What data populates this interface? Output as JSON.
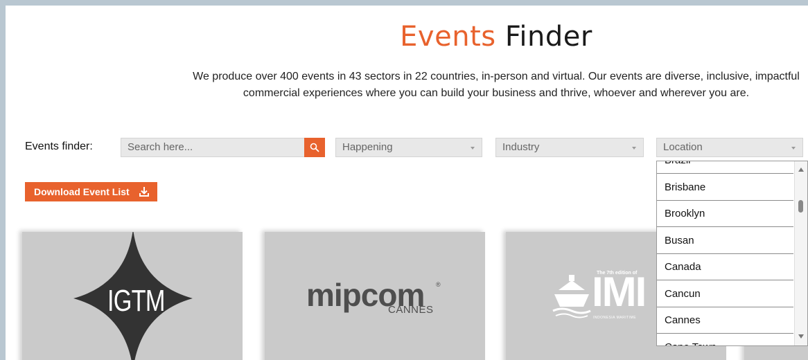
{
  "header": {
    "title_accent": "Events",
    "title_rest": "Finder",
    "intro_line1": "We produce over 400 events in 43 sectors in 22 countries, in-person and virtual. Our events are diverse, inclusive, impactful",
    "intro_line2": "commercial experiences where you can build your business and thrive, whoever and wherever you are."
  },
  "finder": {
    "label": "Events finder:",
    "search_placeholder": "Search here...",
    "happening": "Happening",
    "industry": "Industry",
    "location": "Location"
  },
  "download": {
    "label": "Download Event List"
  },
  "location_options": [
    "Brazil",
    "Brisbane",
    "Brooklyn",
    "Busan",
    "Canada",
    "Cancun",
    "Cannes",
    "Cape Town"
  ],
  "cards": {
    "igtm": "IGTM",
    "mipcom": "mipcom",
    "mipcom_reg": "®",
    "mipcom_sub": "CANNES",
    "imi": "IMI",
    "imi_edition": "The 7th edition of",
    "imi_sub": "INDONESIA MARITIME"
  },
  "colors": {
    "accent": "#e8622d",
    "card_bg": "#cacaca",
    "frame": "#b9c7d1"
  }
}
